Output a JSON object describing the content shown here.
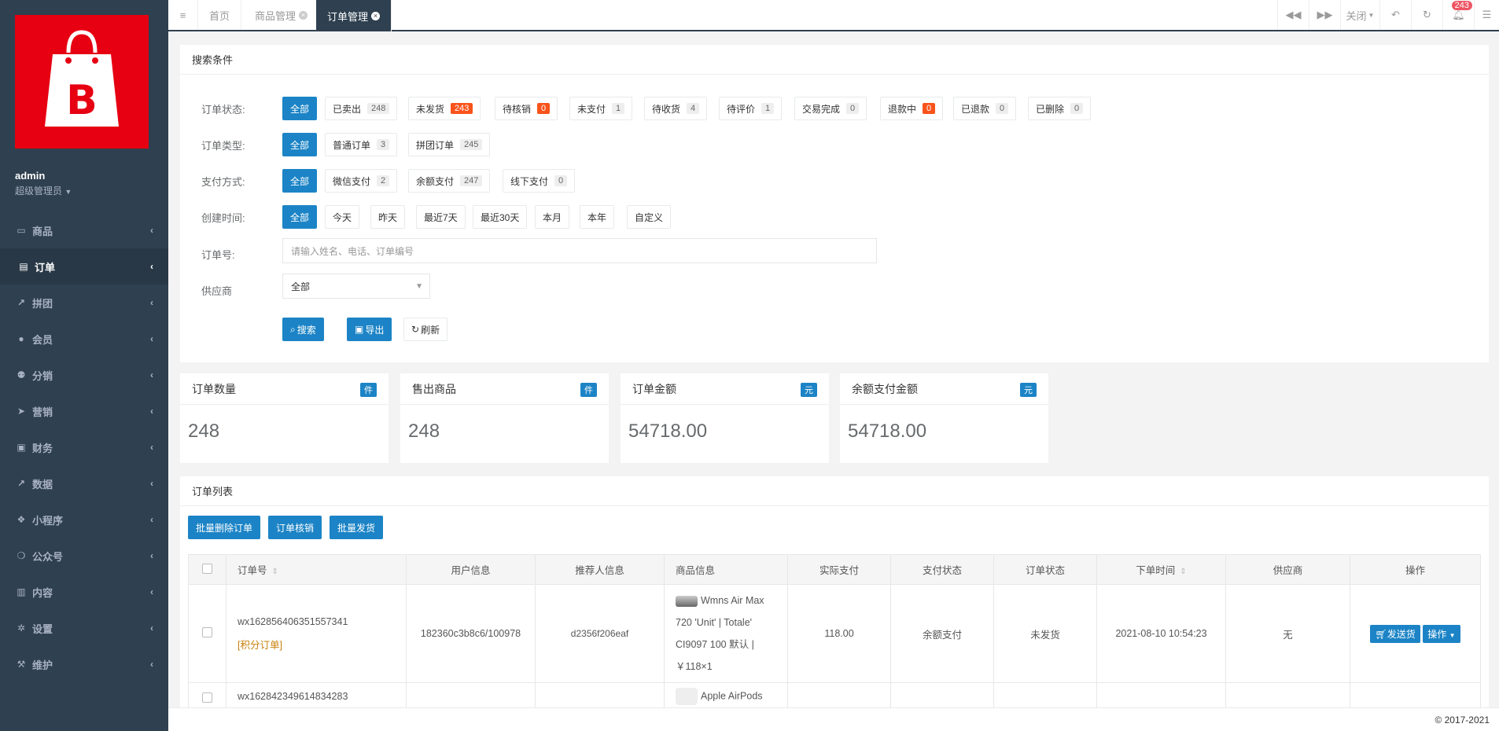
{
  "sidebar": {
    "user": "admin",
    "role": "超级管理员",
    "items": [
      {
        "label": "商品",
        "icon": "laptop-icon"
      },
      {
        "label": "订单",
        "icon": "file-icon"
      },
      {
        "label": "拼团",
        "icon": "line-chart-icon"
      },
      {
        "label": "会员",
        "icon": "user-icon"
      },
      {
        "label": "分销",
        "icon": "users-icon"
      },
      {
        "label": "营销",
        "icon": "send-icon"
      },
      {
        "label": "财务",
        "icon": "money-icon"
      },
      {
        "label": "数据",
        "icon": "chart-icon"
      },
      {
        "label": "小程序",
        "icon": "cubes-icon"
      },
      {
        "label": "公众号",
        "icon": "wechat-icon"
      },
      {
        "label": "内容",
        "icon": "book-icon"
      },
      {
        "label": "设置",
        "icon": "gear-icon"
      },
      {
        "label": "维护",
        "icon": "wrench-icon"
      }
    ]
  },
  "tabs": {
    "home": "首页",
    "goods": "商品管理",
    "orders": "订单管理",
    "close": "关闭",
    "notif_count": "243"
  },
  "search": {
    "title": "搜索条件",
    "status_label": "订单状态:",
    "status": [
      {
        "label": "全部",
        "count": ""
      },
      {
        "label": "已卖出",
        "count": "248"
      },
      {
        "label": "未发货",
        "count": "243"
      },
      {
        "label": "待核销",
        "count": "0"
      },
      {
        "label": "未支付",
        "count": "1"
      },
      {
        "label": "待收货",
        "count": "4"
      },
      {
        "label": "待评价",
        "count": "1"
      },
      {
        "label": "交易完成",
        "count": "0"
      },
      {
        "label": "退款中",
        "count": "0"
      },
      {
        "label": "已退款",
        "count": "0"
      },
      {
        "label": "已删除",
        "count": "0"
      }
    ],
    "type_label": "订单类型:",
    "types": [
      {
        "label": "全部",
        "count": ""
      },
      {
        "label": "普通订单",
        "count": "3"
      },
      {
        "label": "拼团订单",
        "count": "245"
      }
    ],
    "pay_label": "支付方式:",
    "pays": [
      {
        "label": "全部",
        "count": ""
      },
      {
        "label": "微信支付",
        "count": "2"
      },
      {
        "label": "余额支付",
        "count": "247"
      },
      {
        "label": "线下支付",
        "count": "0"
      }
    ],
    "time_label": "创建时间:",
    "times": [
      "全部",
      "今天",
      "昨天",
      "最近7天",
      "最近30天",
      "本月",
      "本年",
      "自定义"
    ],
    "order_label": "订单号:",
    "order_placeholder": "请输入姓名、电话、订单编号",
    "supplier_label": "供应商",
    "supplier_value": "全部",
    "btn_search": "搜索",
    "btn_export": "导出",
    "btn_refresh": "刷新"
  },
  "stats": [
    {
      "title": "订单数量",
      "unit": "件",
      "value": "248"
    },
    {
      "title": "售出商品",
      "unit": "件",
      "value": "248"
    },
    {
      "title": "订单金额",
      "unit": "元",
      "value": "54718.00"
    },
    {
      "title": "余额支付金额",
      "unit": "元",
      "value": "54718.00"
    }
  ],
  "list": {
    "title": "订单列表",
    "btn_batch_delete": "批量删除订单",
    "btn_verify": "订单核销",
    "btn_batch_ship": "批量发货",
    "headers": [
      "订单号",
      "用户信息",
      "推荐人信息",
      "商品信息",
      "实际支付",
      "支付状态",
      "订单状态",
      "下单时间",
      "供应商",
      "操作"
    ],
    "rows": [
      {
        "order_no": "wx162856406351557341",
        "tag": "[积分订单]",
        "user": "182360c3b8c6/100978",
        "referrer": "d2356f206eaf",
        "product": "Wmns Air Max 720 'Unit' | Totale' CI9097 100 默认 | ￥118×1",
        "paid": "118.00",
        "pay_status": "余额支付",
        "order_status": "未发货",
        "time": "2021-08-10 10:54:23",
        "supplier": "无",
        "ship": "发送货",
        "op": "操作"
      },
      {
        "order_no": "wx162842349614834283",
        "product": "Apple AirPods"
      }
    ]
  },
  "footer": "© 2017-2021"
}
